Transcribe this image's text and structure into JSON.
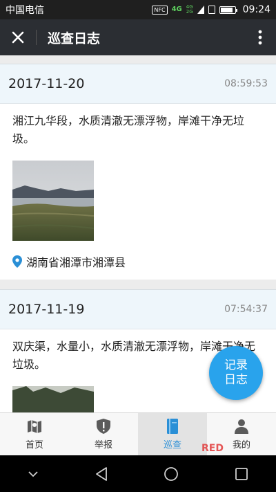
{
  "status_bar": {
    "carrier": "中国电信",
    "nfc": "NFC",
    "net_top": "4G",
    "net_mid": "4G",
    "net_bottom": "2G",
    "battery_level": 0.85,
    "time": "09:24"
  },
  "app_bar": {
    "title": "巡查日志",
    "close_icon": "close-icon",
    "more_icon": "more-vertical-icon"
  },
  "entries": [
    {
      "date": "2017-11-20",
      "time": "08:59:53",
      "text": "湘江九华段，水质清澈无漂浮物，岸滩干净无垃圾。",
      "location": "湖南省湘潭市湘潭县"
    },
    {
      "date": "2017-11-19",
      "time": "07:54:37",
      "text": "双庆渠，水量小，水质清澈无漂浮物，岸滩干净无垃圾。"
    }
  ],
  "fab": {
    "line1": "记录",
    "line2": "日志",
    "color": "#29a3ec"
  },
  "tabs": [
    {
      "label": "首页",
      "icon": "map-icon"
    },
    {
      "label": "举报",
      "icon": "shield-alert-icon"
    },
    {
      "label": "巡查",
      "icon": "notebook-icon",
      "active": true
    },
    {
      "label": "我的",
      "icon": "user-icon"
    }
  ],
  "accent_color": "#2a8fd6",
  "watermark": "RED"
}
